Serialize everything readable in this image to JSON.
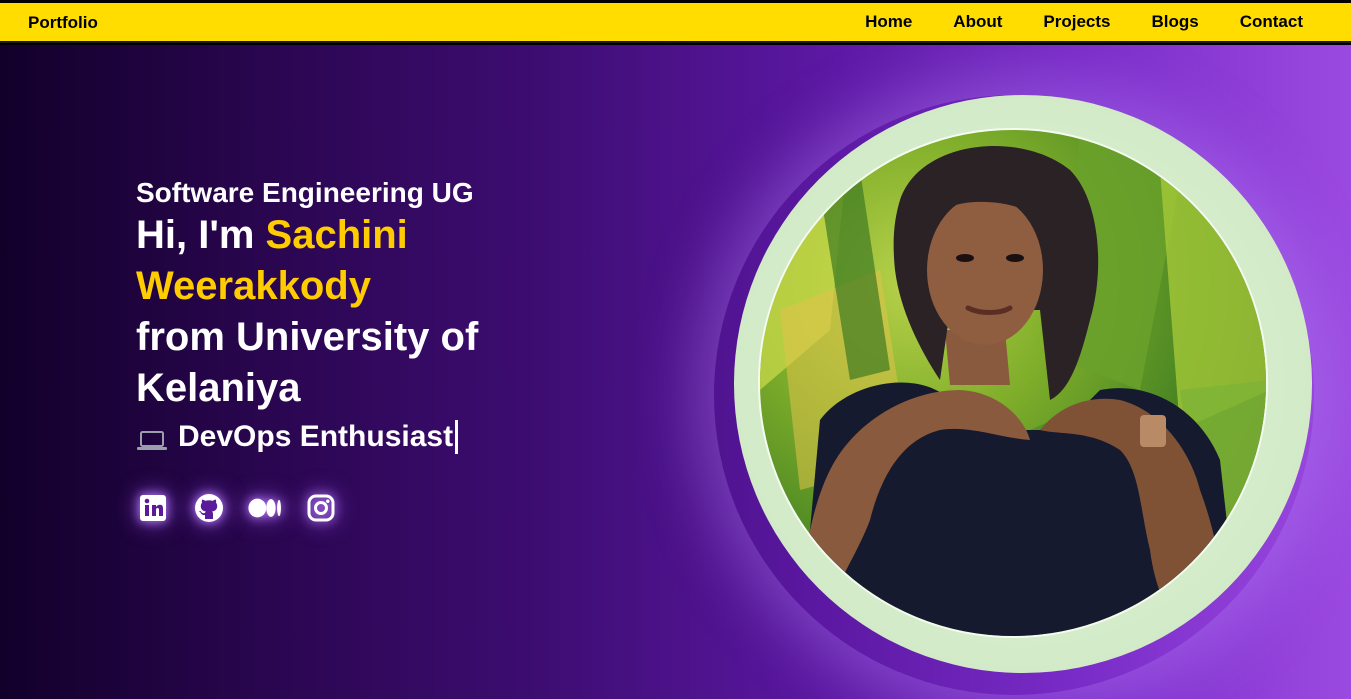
{
  "navbar": {
    "brand": "Portfolio",
    "links": [
      "Home",
      "About",
      "Projects",
      "Blogs",
      "Contact"
    ],
    "background": "#ffdd00"
  },
  "hero": {
    "subtitle": "Software Engineering UG",
    "greeting": "Hi, I'm ",
    "name": "Sachini Weerakkody",
    "from_line": "from University of Kelaniya",
    "role": "DevOps Enthusiast",
    "role_icon": "laptop-icon",
    "accent": "#ffcc00",
    "socials": [
      {
        "name": "linkedin-icon"
      },
      {
        "name": "github-icon"
      },
      {
        "name": "medium-icon"
      },
      {
        "name": "instagram-icon"
      }
    ],
    "photo_ring_color": "#3fae49"
  }
}
